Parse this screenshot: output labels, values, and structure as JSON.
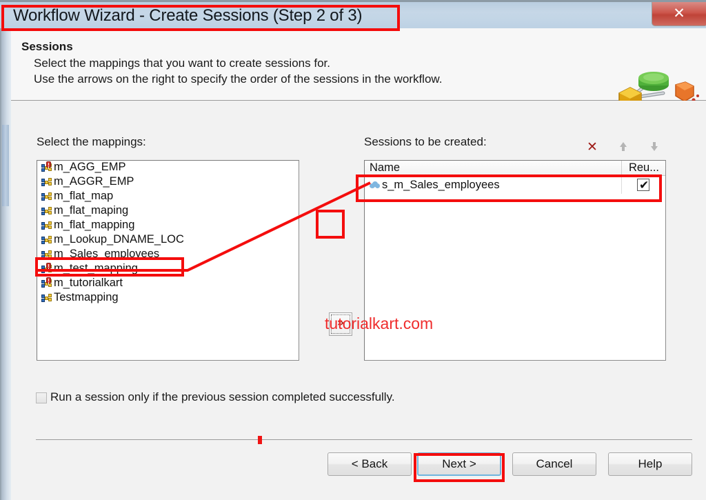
{
  "window": {
    "title": "Workflow Wizard - Create Sessions (Step 2 of 3)",
    "close_label": "✕"
  },
  "header": {
    "title": "Sessions",
    "line1": "Select the mappings that you want to create sessions for.",
    "line2": "Use the arrows on the right to specify the order of the sessions in the workflow."
  },
  "left_panel": {
    "label": "Select the mappings:",
    "items": [
      {
        "name": "m_AGG_EMP",
        "icon": "mapping-invalid-icon",
        "alert": true
      },
      {
        "name": "m_AGGR_EMP",
        "icon": "mapping-icon",
        "alert": false
      },
      {
        "name": "m_flat_map",
        "icon": "mapping-icon",
        "alert": false
      },
      {
        "name": "m_flat_maping",
        "icon": "mapping-icon",
        "alert": false
      },
      {
        "name": "m_flat_mapping",
        "icon": "mapping-icon",
        "alert": false
      },
      {
        "name": "m_Lookup_DNAME_LOC",
        "icon": "mapping-icon",
        "alert": false
      },
      {
        "name": "m_Sales_employees",
        "icon": "mapping-icon",
        "alert": false
      },
      {
        "name": "m_test_mapping",
        "icon": "mapping-invalid-icon",
        "alert": true
      },
      {
        "name": "m_tutorialkart",
        "icon": "mapping-invalid-icon",
        "alert": true
      },
      {
        "name": "Testmapping",
        "icon": "mapping-icon",
        "alert": false
      }
    ]
  },
  "right_panel": {
    "label": "Sessions to be created:",
    "toolbar": {
      "delete_label": "✕",
      "delete_icon": "delete-x-icon",
      "move_up_icon": "arrow-up-icon",
      "move_down_icon": "arrow-down-icon"
    },
    "columns": {
      "name": "Name",
      "reuse": "Reu..."
    },
    "rows": [
      {
        "name": "s_m_Sales_employees",
        "reuse_checked": true,
        "icon": "session-icon"
      }
    ]
  },
  "transfer": {
    "label": "»",
    "icon": "double-chevron-right-icon"
  },
  "watermark": {
    "text": "tutorialkart.com",
    "color": "#ef2c2c"
  },
  "options": {
    "run_if_previous_label": "Run a session only if the previous session completed successfully.",
    "run_if_previous_checked": false
  },
  "footer": {
    "back": "< Back",
    "next": "Next >",
    "cancel": "Cancel",
    "help": "Help"
  },
  "annotations": {
    "color": "#f40d0d",
    "boxes": [
      "title-bar",
      "m_Sales_employees-row",
      "transfer-button",
      "session-row",
      "next-button"
    ],
    "connector": "m_Sales_employees-row to session-row"
  },
  "colors": {
    "titlebar": "#c2d5e6",
    "close_button": "#c04a3e",
    "accent_focus": "#6fb5de",
    "annotation_red": "#f40d0d",
    "watermark_red": "#ef2c2c"
  }
}
